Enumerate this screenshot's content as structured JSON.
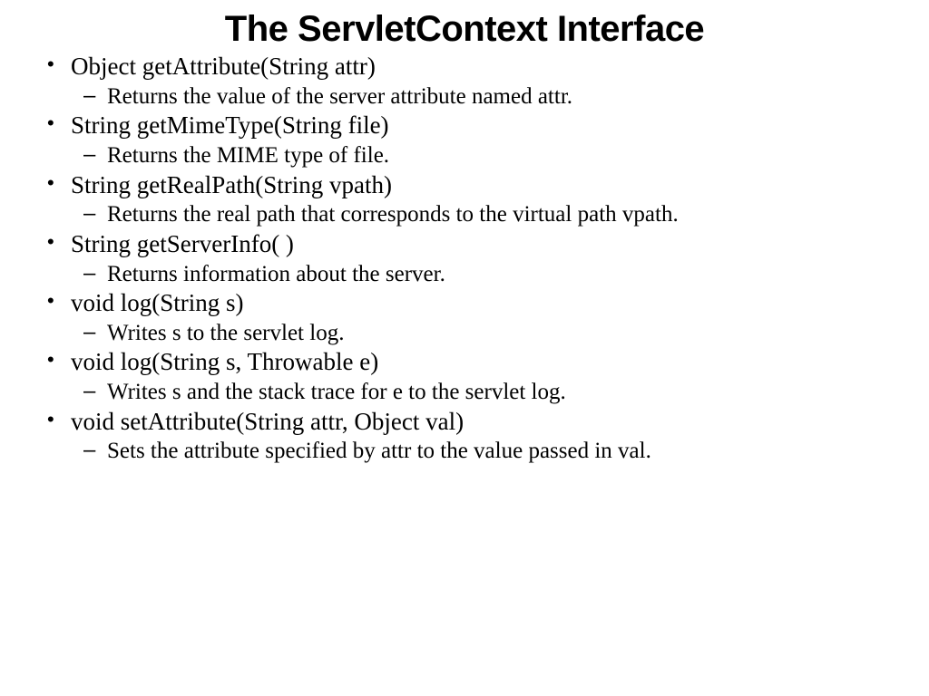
{
  "title": "The ServletContext Interface",
  "methods": [
    {
      "sig": "Object getAttribute(String attr)",
      "desc": "Returns the value of the server attribute named attr."
    },
    {
      "sig": "String getMimeType(String file)",
      "desc": "Returns the MIME type of file."
    },
    {
      "sig": "String getRealPath(String vpath)",
      "desc": "Returns the real path that corresponds to the virtual path vpath."
    },
    {
      "sig": "String getServerInfo( )",
      "desc": "Returns information about the server."
    },
    {
      "sig": "void log(String s)",
      "desc": "Writes s to the servlet log."
    },
    {
      "sig": "void log(String s, Throwable e)",
      "desc": " Writes s and the stack trace for e to the servlet log."
    },
    {
      "sig": "void setAttribute(String attr, Object val)",
      "desc": "Sets the attribute specified by attr to the value passed in val."
    }
  ]
}
